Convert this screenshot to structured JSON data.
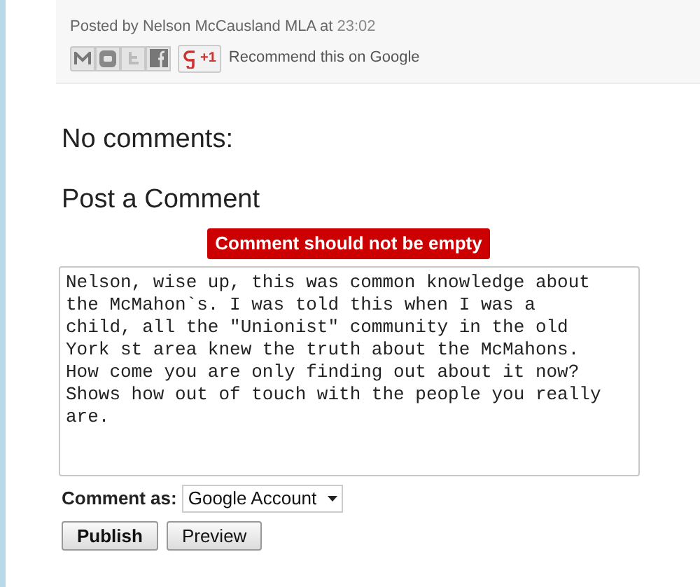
{
  "post_footer": {
    "posted_by": "Posted by Nelson McCausland MLA at",
    "time": "23:02",
    "plus_one": "+1",
    "recommend": "Recommend this on Google"
  },
  "comments_heading": "No comments:",
  "form_heading": "Post a Comment",
  "error": "Comment should not be empty",
  "comment": {
    "value": "Nelson, wise up, this was common knowledge about the McMahon`s. I was told this when I was a child, all the \"Unionist\" community in the old York st area knew the truth about the McMahons. How come you are only finding out about it now? Shows how out of touch with the people you really are."
  },
  "comment_as": {
    "label": "Comment as:",
    "value": "Google Account"
  },
  "buttons": [
    {
      "label": "Publish",
      "primary": true
    },
    {
      "label": "Preview",
      "primary": false
    }
  ]
}
